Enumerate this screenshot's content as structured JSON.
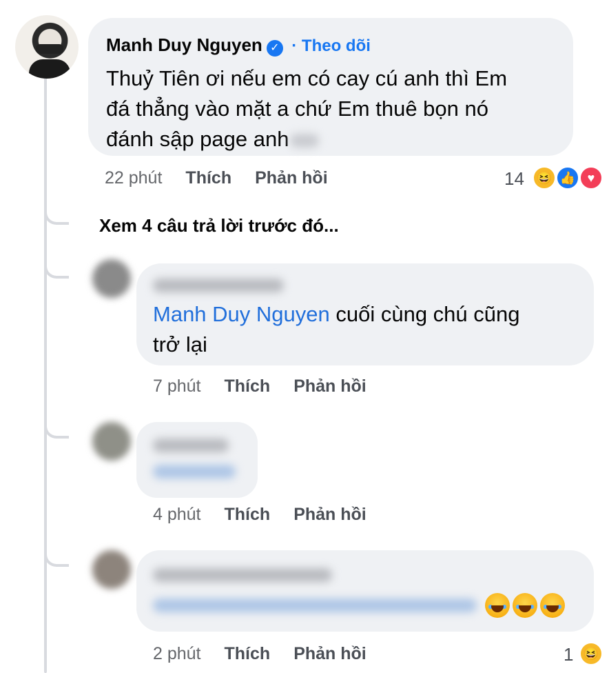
{
  "main_comment": {
    "author": "Manh Duy Nguyen",
    "follow_label": "· Theo dõi",
    "text_lines": [
      "Thuỷ Tiên ơi nếu em có cay cú anh thì Em",
      "đá thẳng vào mặt a chứ Em thuê bọn nó",
      "đánh sập page anh"
    ],
    "time": "22 phút",
    "like_label": "Thích",
    "reply_label": "Phản hồi",
    "reaction_count": "14",
    "reactions": [
      "haha-icon",
      "like-icon",
      "love-icon"
    ]
  },
  "view_previous_label": "Xem 4 câu trả lời trước đó...",
  "replies": [
    {
      "mention": "Manh Duy Nguyen",
      "text_line1": " cuối cùng chú cũng",
      "text_line2": "trở lại",
      "time": "7 phút",
      "like_label": "Thích",
      "reply_label": "Phản hồi"
    },
    {
      "time": "4 phút",
      "like_label": "Thích",
      "reply_label": "Phản hồi"
    },
    {
      "time": "2 phút",
      "like_label": "Thích",
      "reply_label": "Phản hồi",
      "reaction_count": "1",
      "emojis": [
        "tears-of-joy-icon",
        "tears-of-joy-icon",
        "tears-of-joy-icon"
      ]
    }
  ],
  "colors": {
    "accent": "#1877f2",
    "bubble": "#eff1f4",
    "meta": "#65676b"
  }
}
